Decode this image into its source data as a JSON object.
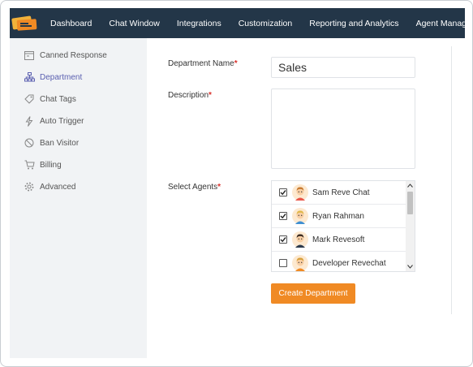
{
  "nav": {
    "items": [
      {
        "label": "Dashboard"
      },
      {
        "label": "Chat Window"
      },
      {
        "label": "Integrations"
      },
      {
        "label": "Customization"
      },
      {
        "label": "Reporting and Analytics"
      },
      {
        "label": "Agent Management"
      }
    ]
  },
  "sidebar": {
    "items": [
      {
        "label": "Canned Response",
        "icon": "canned-response-icon",
        "active": false
      },
      {
        "label": "Department",
        "icon": "department-icon",
        "active": true
      },
      {
        "label": "Chat Tags",
        "icon": "tag-icon",
        "active": false
      },
      {
        "label": "Auto Trigger",
        "icon": "lightning-icon",
        "active": false
      },
      {
        "label": "Ban Visitor",
        "icon": "ban-icon",
        "active": false
      },
      {
        "label": "Billing",
        "icon": "cart-icon",
        "active": false
      },
      {
        "label": "Advanced",
        "icon": "gear-icon",
        "active": false
      }
    ]
  },
  "form": {
    "department_name_label": "Department Name",
    "department_name_value": "Sales",
    "description_label": "Description",
    "description_value": "",
    "select_agents_label": "Select Agents",
    "required_mark": "*",
    "agents": [
      {
        "name": "Sam Reve Chat",
        "checked": true
      },
      {
        "name": "Ryan Rahman",
        "checked": true
      },
      {
        "name": "Mark Revesoft",
        "checked": true
      },
      {
        "name": "Developer Revechat",
        "checked": false
      }
    ],
    "submit_label": "Create Department"
  },
  "colors": {
    "topbar": "#233648",
    "sidebar_bg": "#f1f3f5",
    "active_item": "#5a5fb0",
    "required": "#d9312b",
    "button": "#f08a24"
  }
}
